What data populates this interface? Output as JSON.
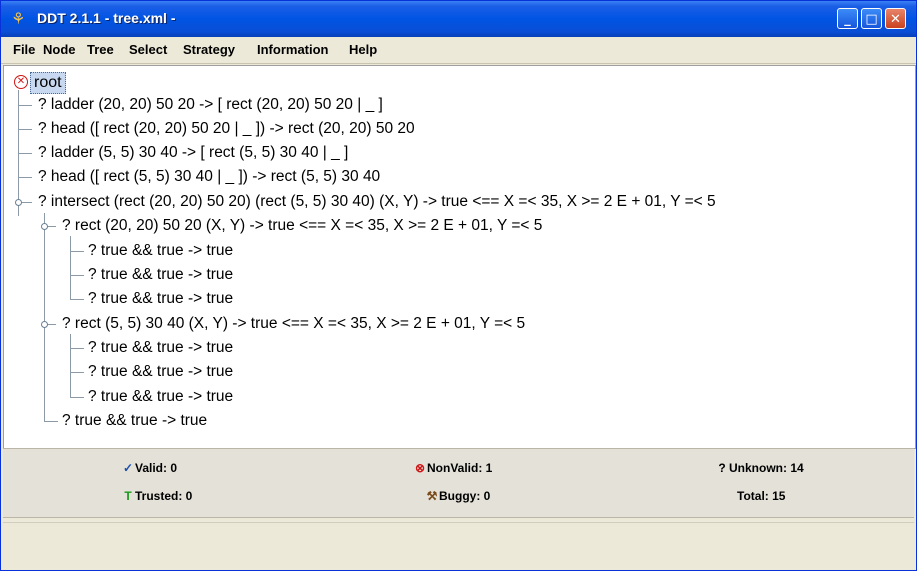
{
  "window": {
    "title": "DDT  2.1.1 - tree.xml -"
  },
  "menu": [
    "File",
    "Node",
    "Tree",
    "Select",
    "Strategy",
    "Information",
    "Help"
  ],
  "tree": {
    "root": "root",
    "nodes": [
      {
        "text": "? ladder  (20, 20) 50 20 -> [ rect  (20, 20) 50 20 | _ ]"
      },
      {
        "text": "? head  ([ rect  (20, 20) 50 20 | _ ]) -> rect  (20, 20) 50 20"
      },
      {
        "text": "? ladder  (5, 5) 30 40 -> [ rect  (5, 5) 30 40 | _ ]"
      },
      {
        "text": "? head  ([ rect  (5, 5) 30 40 | _ ]) -> rect  (5, 5) 30 40"
      },
      {
        "text": "? intersect  (rect  (20, 20) 50 20) (rect  (5, 5) 30 40) (X, Y) -> true <== X  =< 35, X  >= 2 E + 01, Y  =< 5"
      },
      {
        "text": "? rect  (20, 20) 50 20 (X, Y) -> true <== X  =< 35, X  >= 2 E + 01, Y  =< 5"
      },
      {
        "text": "? true  && true -> true"
      },
      {
        "text": "? true  && true -> true"
      },
      {
        "text": "? true  && true -> true"
      },
      {
        "text": "? rect  (5, 5) 30 40 (X, Y) -> true <== X  =< 35, X  >= 2 E + 01, Y  =< 5"
      },
      {
        "text": "? true  && true -> true"
      },
      {
        "text": "? true  && true -> true"
      },
      {
        "text": "? true  && true -> true"
      },
      {
        "text": "? true  && true -> true"
      }
    ]
  },
  "stats": {
    "valid": "Valid: 0",
    "nonvalid": "NonValid: 1",
    "unknown": "Unknown: 14",
    "trusted": "Trusted: 0",
    "buggy": "Buggy: 0",
    "total": "Total: 15"
  },
  "colors": {
    "valid": "#1a4fb0",
    "nonvalid": "#d01515",
    "trusted": "#1a9a1a",
    "buggy": "#7a4a1a"
  }
}
